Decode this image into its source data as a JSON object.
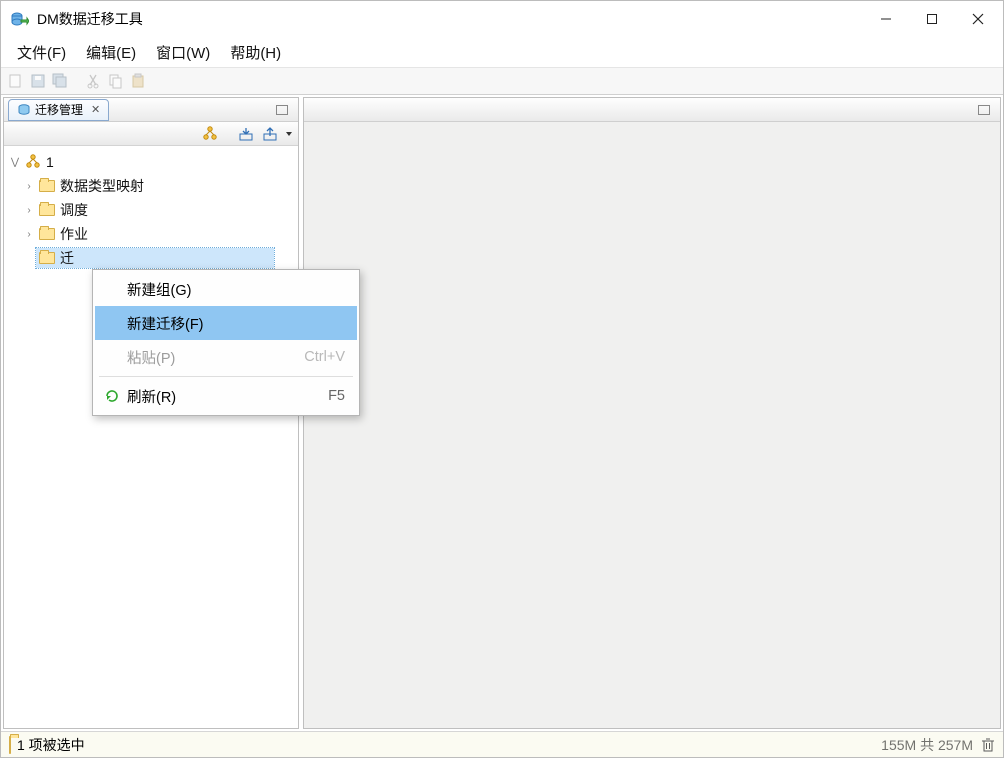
{
  "app": {
    "title": "DM数据迁移工具"
  },
  "menus": {
    "file": "文件(F)",
    "edit": "编辑(E)",
    "window": "窗口(W)",
    "help": "帮助(H)"
  },
  "leftPanel": {
    "title": "迁移管理"
  },
  "tree": {
    "root": "1",
    "items": [
      "数据类型映射",
      "调度",
      "作业",
      "迁"
    ]
  },
  "contextMenu": {
    "newGroup": "新建组(G)",
    "newMigration": "新建迁移(F)",
    "paste": "粘贴(P)",
    "pasteShortcut": "Ctrl+V",
    "refresh": "刷新(R)",
    "refreshShortcut": "F5"
  },
  "status": {
    "text": "1 项被选中",
    "memory": "155M 共 257M"
  }
}
